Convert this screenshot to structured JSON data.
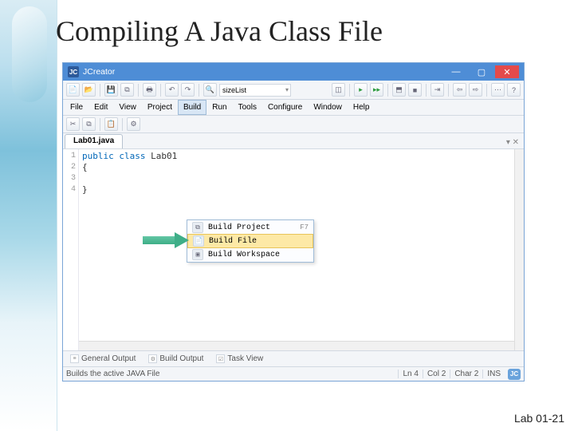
{
  "slide": {
    "title": "Compiling A Java Class File",
    "footer": "Lab 01-21"
  },
  "window": {
    "app_name": "JCreator",
    "icon_text": "JC",
    "min": "—",
    "max": "▢",
    "close": "✕"
  },
  "toolbar": {
    "combo": "sizeList"
  },
  "menu": {
    "items": [
      "File",
      "Edit",
      "View",
      "Project",
      "Build",
      "Run",
      "Tools",
      "Configure",
      "Window",
      "Help"
    ]
  },
  "dropdown": {
    "items": [
      {
        "label": "Build Project",
        "shortcut": "F7",
        "hl": false
      },
      {
        "label": "Build File",
        "shortcut": "",
        "hl": true
      },
      {
        "label": "Build Workspace",
        "shortcut": "",
        "hl": false
      }
    ]
  },
  "tab": {
    "label": "Lab01.java"
  },
  "code": {
    "lines": [
      "1",
      "2",
      "3",
      "4"
    ],
    "l1_a": "public class",
    "l1_b": " Lab01",
    "l2": "{",
    "l3": "",
    "l4": "}"
  },
  "bottomTabs": {
    "a": "General Output",
    "b": "Build Output",
    "c": "Task View"
  },
  "status": {
    "msg": "Builds the active JAVA File",
    "ln": "Ln 4",
    "col": "Col 2",
    "char": "Char 2",
    "caps": "INS",
    "logo": "JC"
  }
}
